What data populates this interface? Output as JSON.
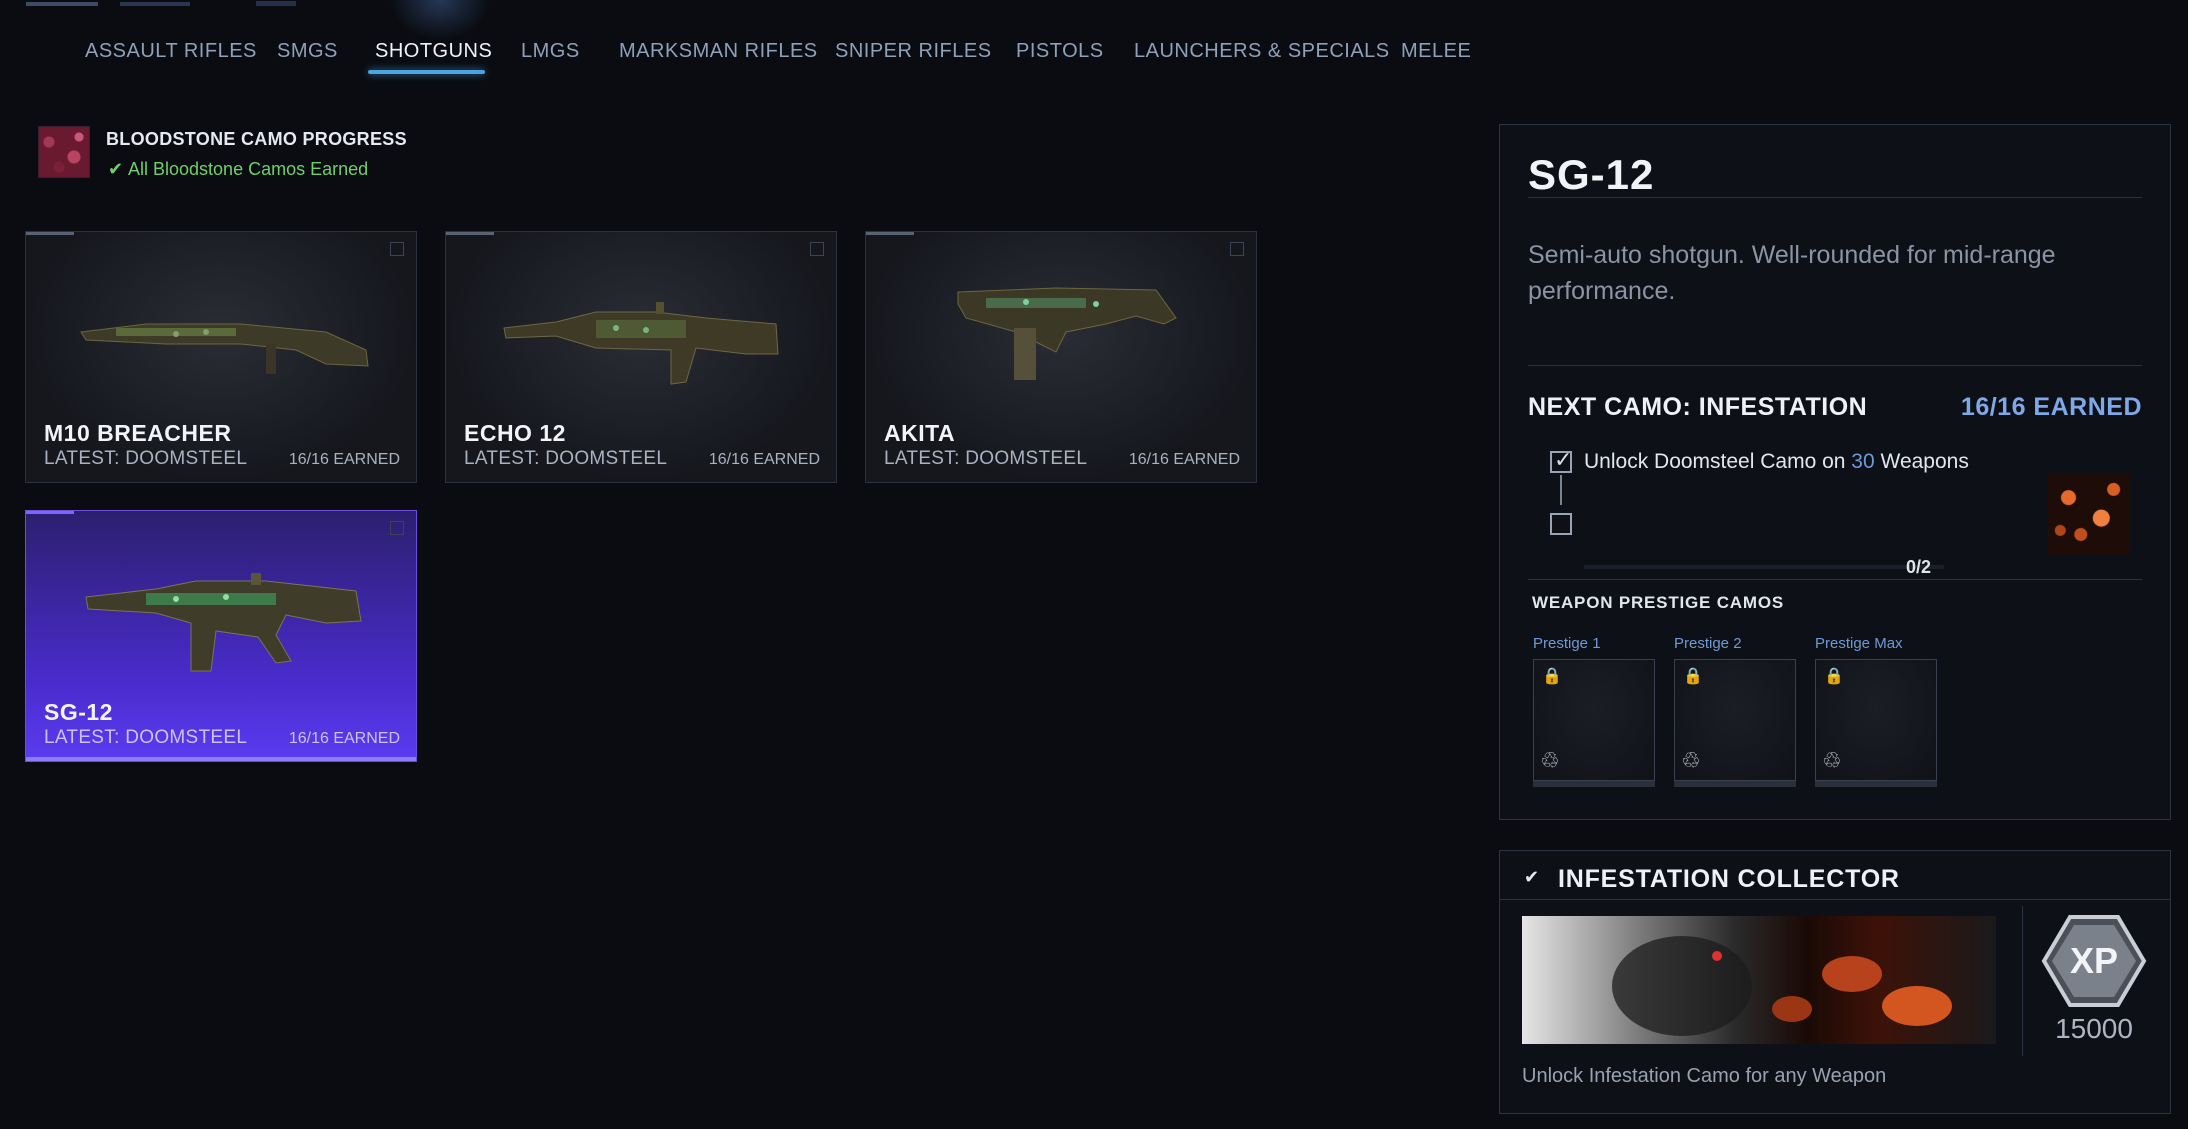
{
  "nav": {
    "tabs": [
      {
        "label": "ASSAULT RIFLES"
      },
      {
        "label": "SMGS"
      },
      {
        "label": "SHOTGUNS",
        "active": true
      },
      {
        "label": "LMGS"
      },
      {
        "label": "MARKSMAN RIFLES"
      },
      {
        "label": "SNIPER RIFLES"
      },
      {
        "label": "PISTOLS"
      },
      {
        "label": "LAUNCHERS & SPECIALS"
      },
      {
        "label": "MELEE"
      }
    ]
  },
  "camo_progress": {
    "title": "BLOODSTONE CAMO PROGRESS",
    "status": "All Bloodstone Camos Earned",
    "status_color": "#6fd06a"
  },
  "weapons": [
    {
      "name": "M10 BREACHER",
      "latest": "LATEST: DOOMSTEEL",
      "earned": "16/16 EARNED"
    },
    {
      "name": "ECHO 12",
      "latest": "LATEST: DOOMSTEEL",
      "earned": "16/16 EARNED"
    },
    {
      "name": "AKITA",
      "latest": "LATEST: DOOMSTEEL",
      "earned": "16/16 EARNED"
    },
    {
      "name": "SG-12",
      "latest": "LATEST: DOOMSTEEL",
      "earned": "16/16 EARNED",
      "selected": true
    }
  ],
  "detail": {
    "name": "SG-12",
    "description": "Semi-auto shotgun. Well-rounded for mid-range performance.",
    "next_camo": "NEXT CAMO: INFESTATION",
    "next_earned": "16/16 EARNED",
    "task_prefix": "Unlock Doomsteel Camo on",
    "task_number": "30",
    "task_suffix": "Weapons",
    "task_progress": "0/2",
    "prestige_title": "WEAPON PRESTIGE CAMOS",
    "prestige_slots": [
      {
        "label": "Prestige 1"
      },
      {
        "label": "Prestige 2"
      },
      {
        "label": "Prestige Max"
      }
    ]
  },
  "collector": {
    "title": "INFESTATION COLLECTOR",
    "xp_label": "XP",
    "xp_value": "15000",
    "description": "Unlock Infestation Camo for any Weapon"
  },
  "colors": {
    "accent": "#4ba3e0",
    "selected_card": "#5b3cf0",
    "earned_blue": "#7fa8e8"
  }
}
